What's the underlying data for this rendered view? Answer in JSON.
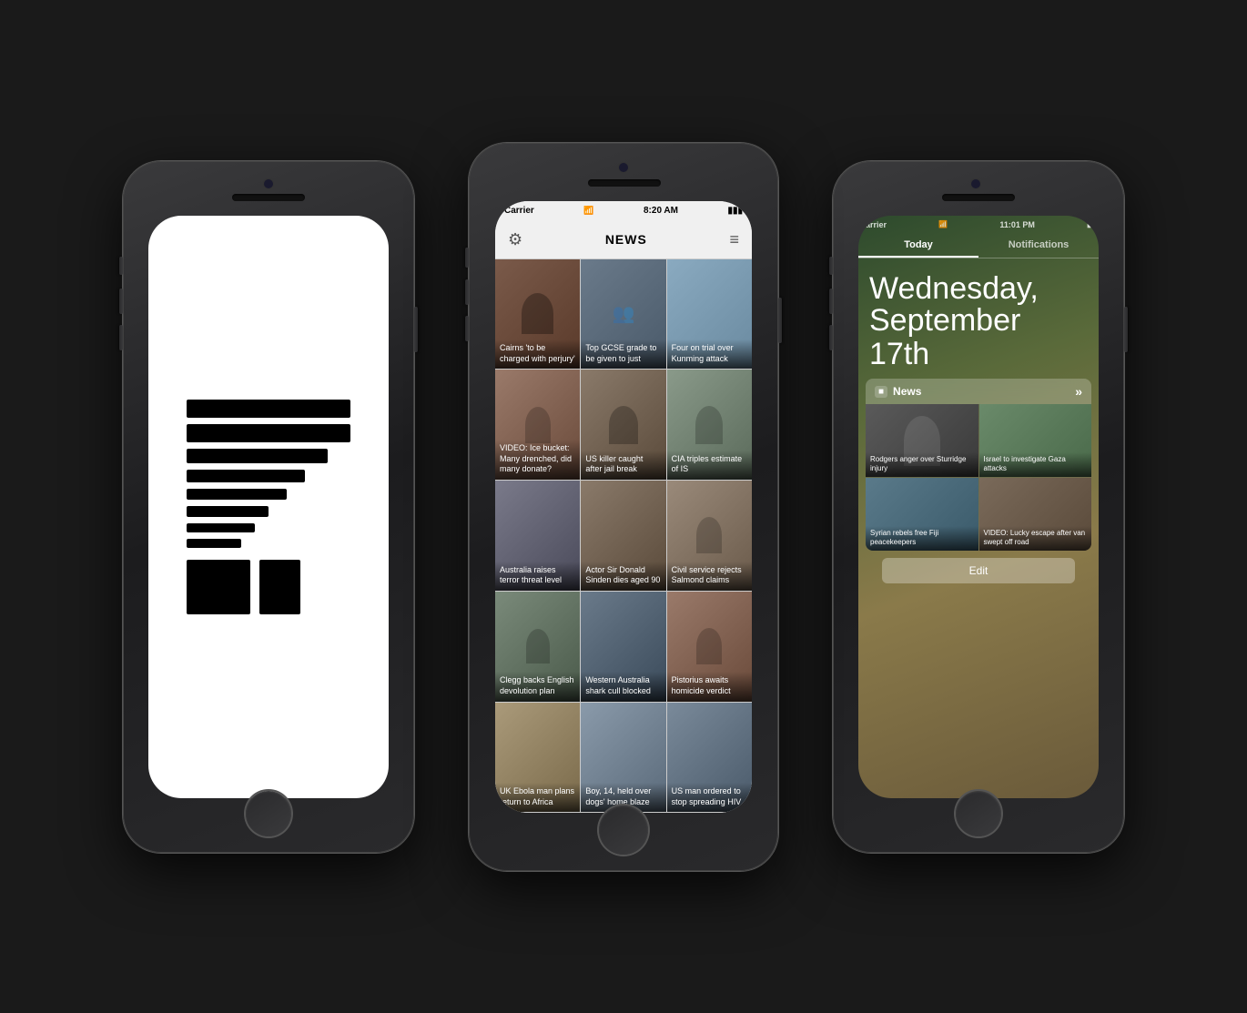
{
  "scene": {
    "background": "#1a1a1a"
  },
  "left_phone": {
    "logo_bars": [
      100,
      100,
      85,
      70,
      60,
      50,
      40,
      30,
      25,
      20
    ]
  },
  "center_phone": {
    "status": {
      "carrier": "Carrier",
      "time": "8:20 AM",
      "battery": "▮▮▮"
    },
    "nav": {
      "title": "NEWS",
      "left_icon": "⚙",
      "right_icon": "≡"
    },
    "news_items": [
      {
        "id": "r1c1",
        "caption": "Cairns 'to be charged with perjury'",
        "color": "#6b4c3b"
      },
      {
        "id": "r1c2",
        "caption": "Top GCSE grade to be given to just",
        "color": "#4a5a6b"
      },
      {
        "id": "r1c3",
        "caption": "Four on trial over Kunming attack",
        "color": "#7a9ab0"
      },
      {
        "id": "r2c1",
        "caption": "VIDEO: Ice bucket: Many drenched, did many donate?",
        "color": "#8a5a4a"
      },
      {
        "id": "r2c2",
        "caption": "US killer caught after jail break",
        "color": "#7a6a5a"
      },
      {
        "id": "r2c3",
        "caption": "CIA triples estimate of IS",
        "color": "#6a7a6a"
      },
      {
        "id": "r3c1",
        "caption": "Australia raises terror threat level",
        "color": "#5a5a6a"
      },
      {
        "id": "r3c2",
        "caption": "Actor Sir Donald Sinden dies aged 90",
        "color": "#6a5a4a"
      },
      {
        "id": "r3c3",
        "caption": "Civil service rejects Salmond claims",
        "color": "#7a6a5a"
      },
      {
        "id": "r4c1",
        "caption": "Clegg backs English devolution plan",
        "color": "#5a6a5a"
      },
      {
        "id": "r4c2",
        "caption": "Western Australia shark cull blocked",
        "color": "#4a5a6a"
      },
      {
        "id": "r4c3",
        "caption": "Pistorius awaits homicide verdict",
        "color": "#7a5a4a"
      },
      {
        "id": "r5c1",
        "caption": "UK Ebola man plans return to Africa",
        "color": "#8a7a5a"
      },
      {
        "id": "r5c2",
        "caption": "Boy, 14, held over dogs' home blaze",
        "color": "#6a7a8a"
      },
      {
        "id": "r5c3",
        "caption": "US man ordered to stop spreading HIV",
        "color": "#5a6a7a"
      }
    ]
  },
  "right_phone": {
    "status": {
      "carrier": "arrier",
      "time": "11:01 PM",
      "battery": "▮"
    },
    "tabs": [
      "Today",
      "Notifications"
    ],
    "active_tab": "Today",
    "date": {
      "line1": "Wednesday,",
      "line2": "September 17th"
    },
    "section_title": "News",
    "news_items": [
      {
        "id": "rn1",
        "caption": "Rodgers anger over Sturridge injury",
        "color": "#4a4a4a"
      },
      {
        "id": "rn2",
        "caption": "Israel to investigate Gaza attacks",
        "color": "#5a7a5a"
      },
      {
        "id": "rn3",
        "caption": "Syrian rebels free Fiji peacekeepers",
        "color": "#4a6a7a"
      },
      {
        "id": "rn4",
        "caption": "VIDEO: Lucky escape after van swept off road",
        "color": "#6a5a4a"
      }
    ],
    "edit_button": "Edit"
  }
}
